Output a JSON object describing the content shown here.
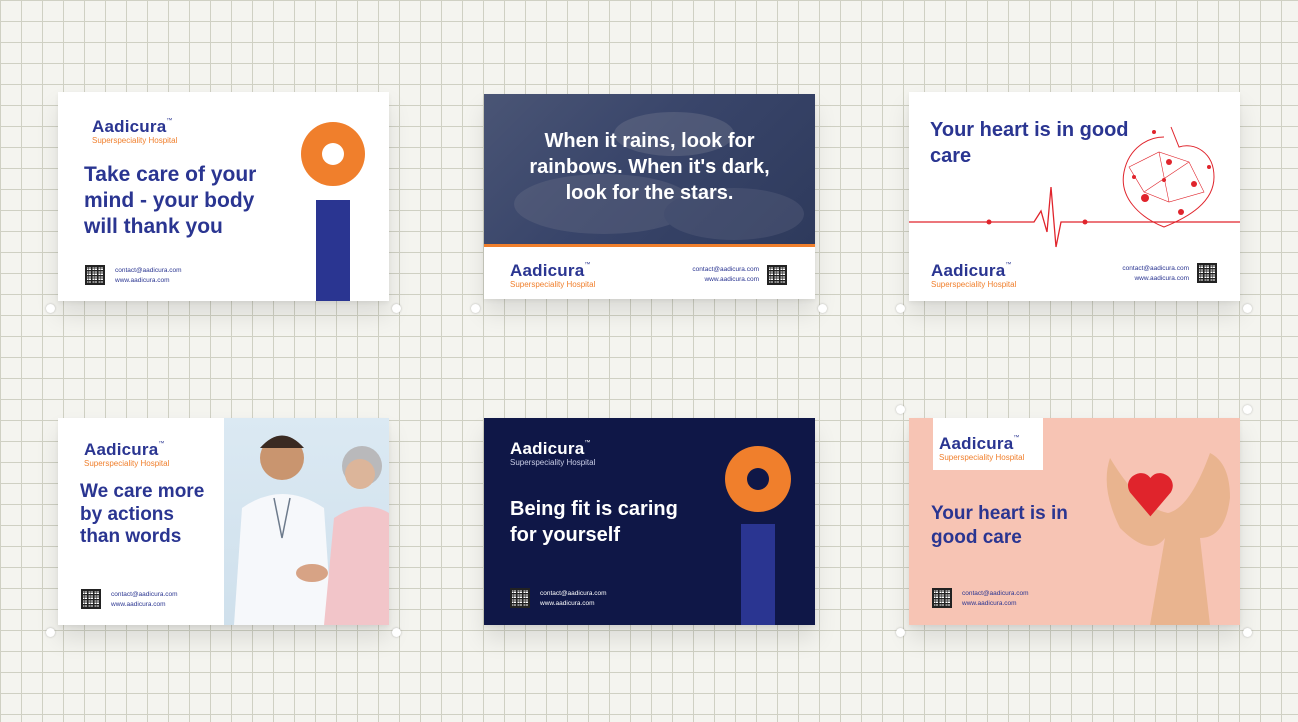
{
  "brand": {
    "name": "Aadicura",
    "trademark": "™",
    "tagline": "Superspeciality Hospital",
    "email": "contact@aadicura.com",
    "website": "www.aadicura.com"
  },
  "cards": [
    {
      "headline": "Take care of your mind - your body will thank you"
    },
    {
      "headline": "When it rains, look for rainbows. When it's dark, look for the stars."
    },
    {
      "headline": "Your heart is in good care"
    },
    {
      "headline": "We care more by actions than words"
    },
    {
      "headline": "Being fit is caring for yourself"
    },
    {
      "headline": "Your heart is in good care"
    }
  ],
  "colors": {
    "brand_navy": "#2a3591",
    "brand_orange": "#f07f2c",
    "dark_background": "#0f1747",
    "pink_background": "#f7c4b4",
    "heart_red": "#e0242c"
  },
  "icons": [
    "qr-code-icon",
    "heart-illustration-icon",
    "heartbeat-line-icon"
  ]
}
